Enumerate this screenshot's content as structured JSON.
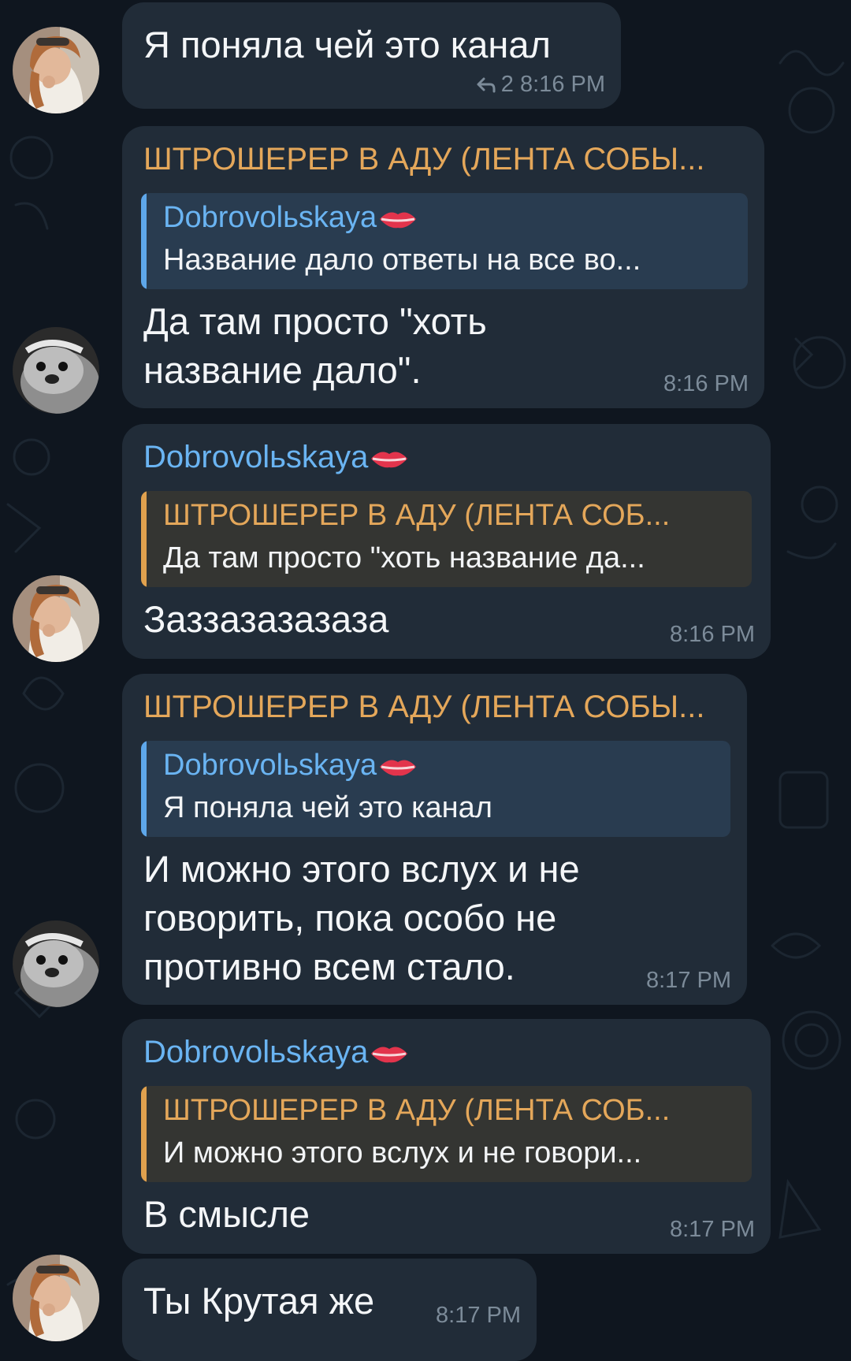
{
  "messages": [
    {
      "sender": "",
      "text": [
        "Я поняла чей это канал"
      ],
      "replies": "2",
      "time": "8:16 PM"
    },
    {
      "sender": "ШТРОШЕРЕР В АДУ (ЛЕНТА СОБЫ...",
      "quote_name": "Dobrovolьskaya",
      "quote_text": "Название дало ответы на все во...",
      "text": [
        "Да там просто \"хоть",
        "название дало\"."
      ],
      "time": "8:16 PM"
    },
    {
      "sender": "Dobrovolьskaya",
      "quote_name": "ШТРОШЕРЕР В АДУ (ЛЕНТА СОБ...",
      "quote_text": "Да там просто \"хоть название да...",
      "text": [
        "Заззазазазаза"
      ],
      "time": "8:16 PM"
    },
    {
      "sender": "ШТРОШЕРЕР В АДУ (ЛЕНТА СОБЫ...",
      "quote_name": "Dobrovolьskaya",
      "quote_text": "Я поняла чей это канал",
      "text": [
        "И можно этого вслух и не",
        "говорить, пока особо не",
        "противно всем стало."
      ],
      "time": "8:17 PM"
    },
    {
      "sender": "Dobrovolьskaya",
      "quote_name": "ШТРОШЕРЕР В АДУ (ЛЕНТА СОБ...",
      "quote_text": "И можно этого вслух и не говори...",
      "text": [
        "В смысле"
      ],
      "time": "8:17 PM"
    },
    {
      "sender": "",
      "text": [
        "Ты Крутая же"
      ],
      "time": "8:17 PM"
    }
  ],
  "colors": {
    "background": "#0f161f",
    "bubble": "#212c38",
    "orange_name": "#e4a75a",
    "blue_name": "#6ab4f2",
    "time": "#7c8b99"
  },
  "icons": [
    "reply-arrow-icon",
    "lips-emoji-icon",
    "avatar-girl",
    "avatar-otter"
  ]
}
